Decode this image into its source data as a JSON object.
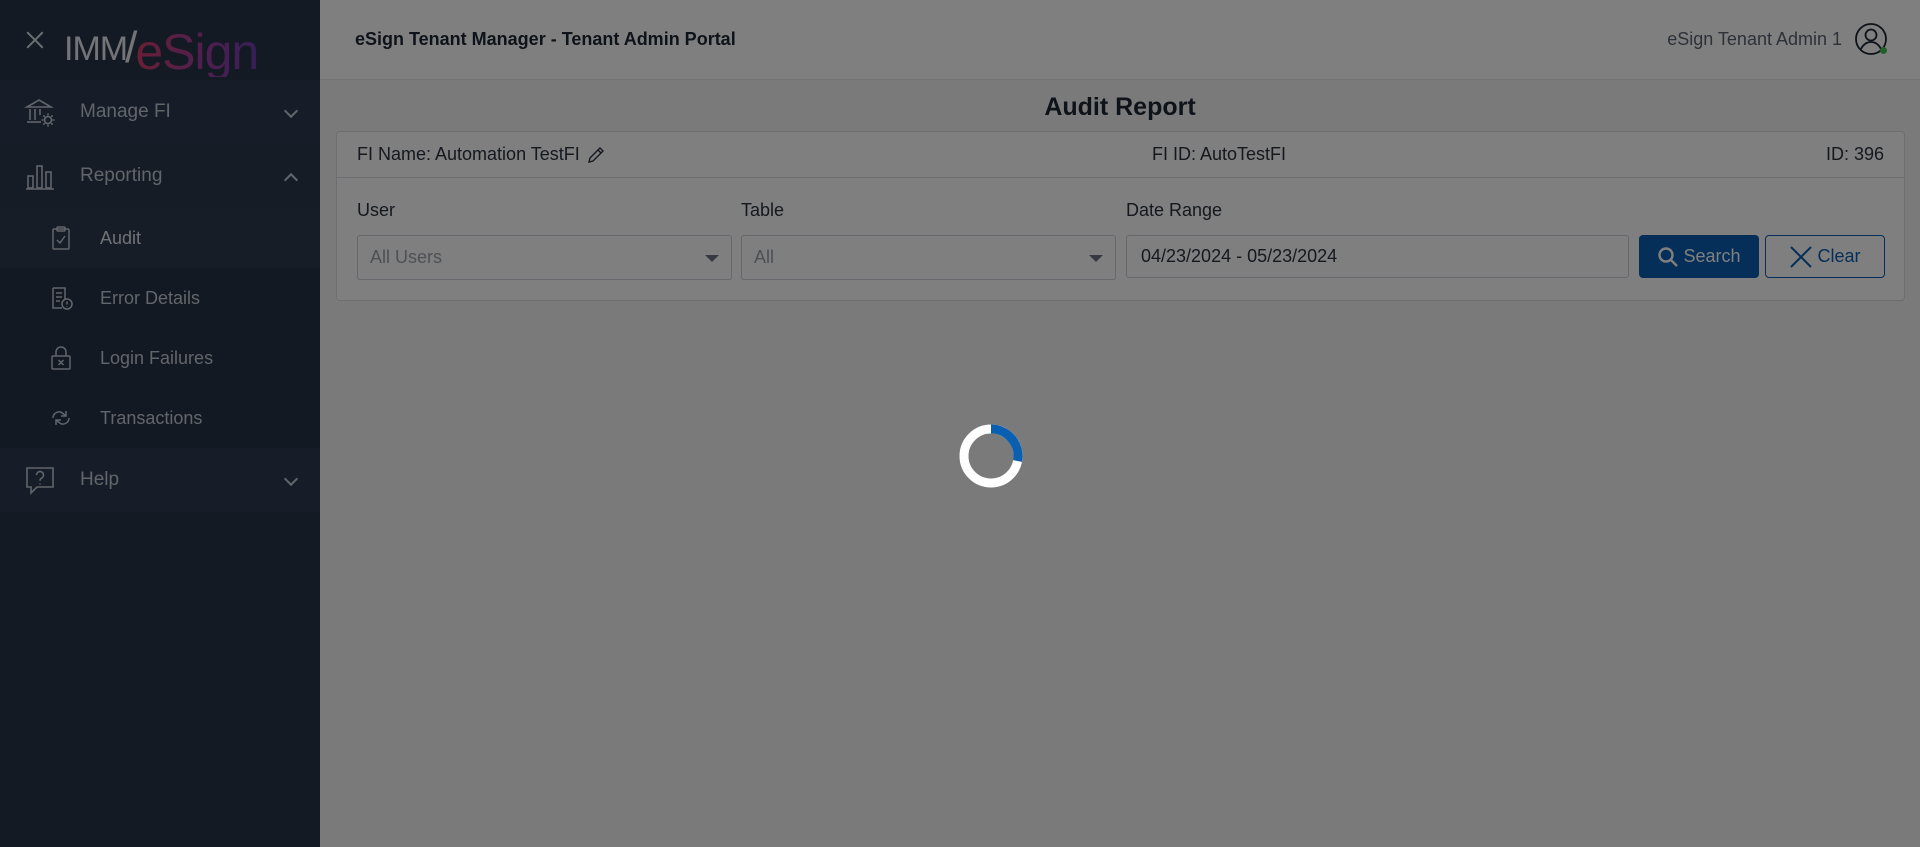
{
  "app": {
    "logo_prefix": "IMM",
    "logo_slash": "/",
    "logo_brand": "eSign",
    "portal_title": "eSign Tenant Manager - Tenant Admin Portal",
    "user_name": "eSign Tenant Admin 1"
  },
  "sidebar": {
    "sections": [
      {
        "label": "Manage FI",
        "icon": "bank-gear-icon",
        "expanded": false
      },
      {
        "label": "Reporting",
        "icon": "bar-chart-icon",
        "expanded": true
      },
      {
        "label": "Help",
        "icon": "help-bubble-icon",
        "expanded": false
      }
    ],
    "reporting_items": [
      {
        "label": "Audit",
        "icon": "clipboard-check-icon",
        "active": true
      },
      {
        "label": "Error Details",
        "icon": "report-error-icon",
        "active": false
      },
      {
        "label": "Login Failures",
        "icon": "lock-x-icon",
        "active": false
      },
      {
        "label": "Transactions",
        "icon": "cycle-arrows-icon",
        "active": false
      }
    ]
  },
  "main": {
    "page_title": "Audit Report",
    "fi_name": "FI Name: Automation TestFI",
    "fi_id": "FI ID: AutoTestFI",
    "id": "ID: 396",
    "filters": {
      "user_label": "User",
      "user_value": "All Users",
      "table_label": "Table",
      "table_value": "All",
      "date_label": "Date Range",
      "date_value": "04/23/2024 - 05/23/2024"
    },
    "search_label": "Search",
    "clear_label": "Clear"
  },
  "colors": {
    "primary": "#0a5fb0",
    "sidebar_bg": "#283548",
    "overlay": "rgba(0,0,0,0.5)"
  },
  "loading": true
}
